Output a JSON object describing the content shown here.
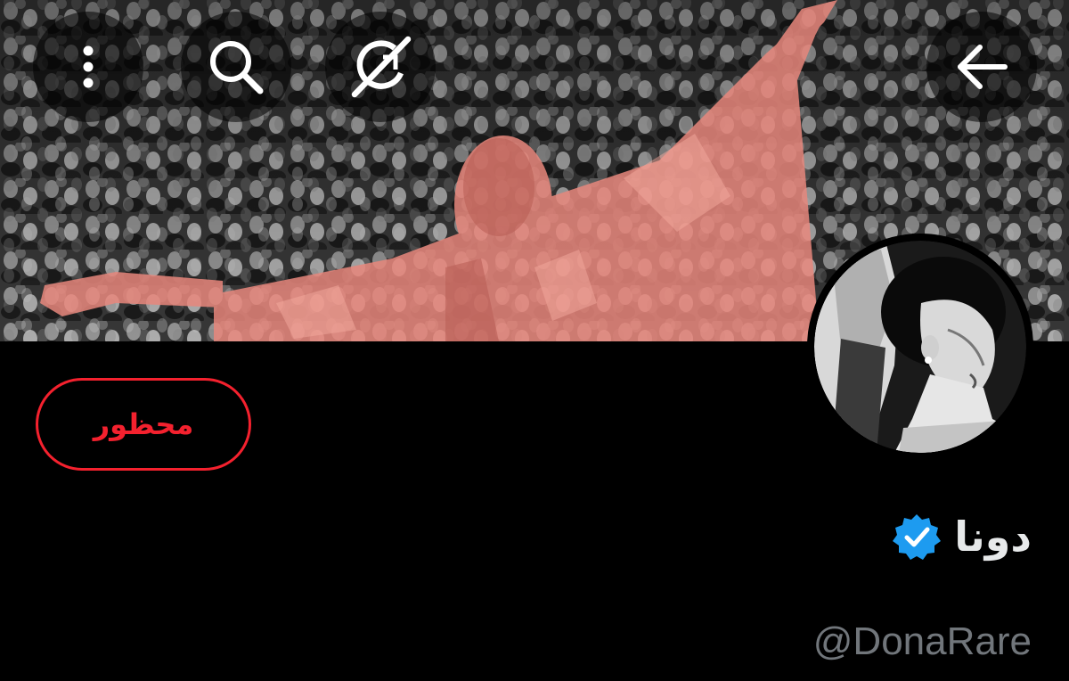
{
  "header": {
    "icons": {
      "more": "more-vertical-icon",
      "search": "search-icon",
      "grok": "grok-icon",
      "back": "back-arrow-icon"
    }
  },
  "profile": {
    "display_name": "دونا",
    "verified": true,
    "handle": "@DonaRare",
    "relationship_button_label": "محظور"
  },
  "colors": {
    "background": "#000000",
    "blocked_red": "#f4212e",
    "verified_blue": "#1d9bf0",
    "name_text": "#e7e9ea",
    "handle_text": "#71767b",
    "banner_tint": "#e8877c"
  }
}
